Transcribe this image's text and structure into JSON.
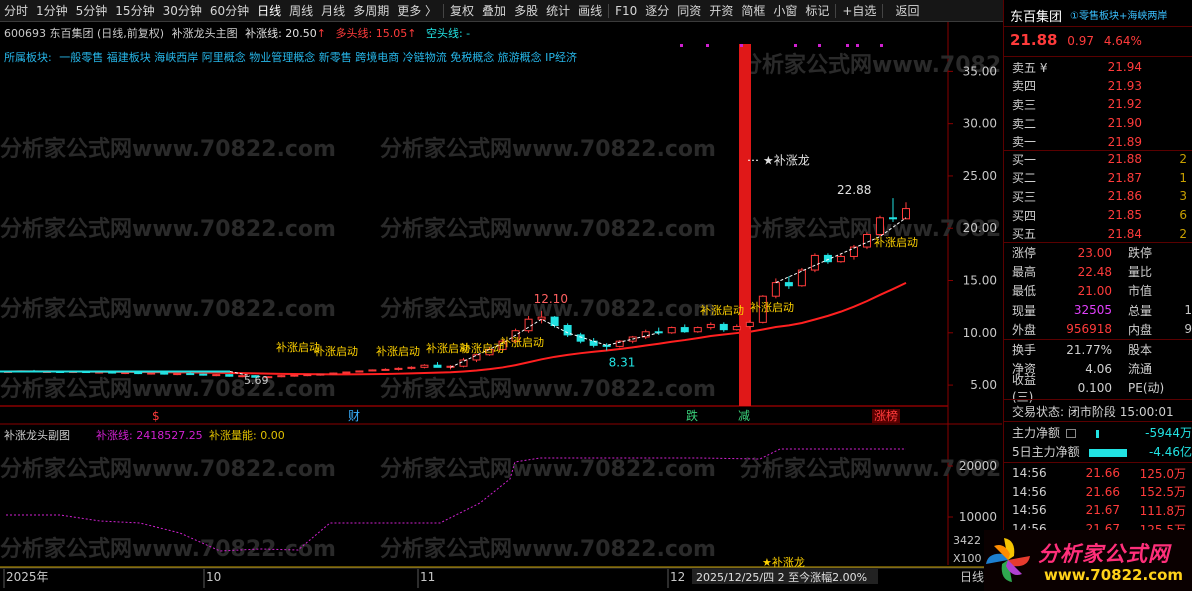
{
  "toolbar": {
    "items": [
      "分时",
      "1分钟",
      "5分钟",
      "15分钟",
      "30分钟",
      "60分钟",
      "日线",
      "周线",
      "月线",
      "多周期",
      "更多 〉",
      "复权",
      "叠加",
      "多股",
      "统计",
      "画线",
      "F10",
      "逐分",
      "同资",
      "开资",
      "简框",
      "小窗",
      "标记",
      "+自选",
      "返回"
    ],
    "active": "日线"
  },
  "main_chart": {
    "code_name": "600693 东百集团 (日线,前复权)",
    "indicator_name": "补涨龙头主图",
    "buzhang_label": "补涨线:",
    "buzhang_value": "20.50",
    "duotou_label": "多头线:",
    "duotou_value": "15.05",
    "kongtou_label": "空头线:",
    "kongtou_value": "-",
    "sectors_label": "所属板块:",
    "sectors": "一般零售 福建板块 海峡西岸 阿里概念 物业管理概念 新零售 跨境电商 冷链物流 免税概念 旅游概念 IP经济"
  },
  "chart_data": [
    {
      "type": "candlestick",
      "ylim": [
        3,
        38
      ],
      "y_ticks": [
        "35.00",
        "30.00",
        "25.00",
        "20.00",
        "15.00",
        "10.00",
        "5.00"
      ],
      "annotations": {
        "high1": "12.10",
        "low1": "8.31",
        "high2": "22.88",
        "low0": "5.69",
        "dragon": "★补涨龙",
        "start_label": "补涨启动"
      },
      "bottom_markers": [
        "$",
        "财",
        "跌",
        "减",
        "涨榜"
      ]
    },
    {
      "type": "line",
      "title": "补涨龙头副图",
      "series_label": "补涨线:",
      "series_value": "2418527.25",
      "energy_label": "补涨量能:",
      "energy_value": "0.00",
      "y_ticks": [
        "20000",
        "10000"
      ],
      "extra_ticks": [
        "3422",
        "X100"
      ],
      "bottom_annotation": "★补涨龙"
    }
  ],
  "timeline": {
    "labels": [
      "2025年",
      "10",
      "11",
      "12"
    ],
    "cursor": "2025/12/25/四 2 至今涨幅2.00%",
    "right_tag": "日线"
  },
  "quote": {
    "name": "东百集团",
    "sector": "①零售板块+海峡两岸",
    "price": "21.88",
    "change": "0.97",
    "pct": "4.64%",
    "sells": [
      {
        "label": "卖五 ¥",
        "price": "21.94"
      },
      {
        "label": "卖四",
        "price": "21.93"
      },
      {
        "label": "卖三",
        "price": "21.92"
      },
      {
        "label": "卖二",
        "price": "21.90"
      },
      {
        "label": "卖一",
        "price": "21.89"
      }
    ],
    "buys": [
      {
        "label": "买一",
        "price": "21.88",
        "tail": "2"
      },
      {
        "label": "买二",
        "price": "21.87",
        "tail": "1"
      },
      {
        "label": "买三",
        "price": "21.86",
        "tail": "3"
      },
      {
        "label": "买四",
        "price": "21.85",
        "tail": "6"
      },
      {
        "label": "买五",
        "price": "21.84",
        "tail": "2"
      }
    ],
    "stats": [
      {
        "l1": "涨停",
        "v1": "23.00",
        "c1": "#ff3b3b",
        "l2": "跌停",
        "v2": ""
      },
      {
        "l1": "最高",
        "v1": "22.48",
        "c1": "#ff3b3b",
        "l2": "量比",
        "v2": ""
      },
      {
        "l1": "最低",
        "v1": "21.00",
        "c1": "#ff3b3b",
        "l2": "市值",
        "v2": ""
      },
      {
        "l1": "现量",
        "v1": "32505",
        "c1": "#e040fb",
        "l2": "总量",
        "v2": "1"
      },
      {
        "l1": "外盘",
        "v1": "956918",
        "c1": "#ff3b3b",
        "l2": "内盘",
        "v2": "9"
      }
    ],
    "stats2": [
      {
        "l1": "换手",
        "v1": "21.77%",
        "c1": "#d0d0d0",
        "l2": "股本",
        "v2": ""
      },
      {
        "l1": "净资",
        "v1": "4.06",
        "c1": "#d0d0d0",
        "l2": "流通",
        "v2": ""
      },
      {
        "l1": "收益(三)",
        "v1": "0.100",
        "c1": "#d0d0d0",
        "l2": "PE(动)",
        "v2": ""
      }
    ],
    "trade_status_label": "交易状态:",
    "trade_status": "闭市阶段 15:00:01",
    "main_flow_label": "主力净额",
    "main_flow": "-5944万",
    "main_flow5_label": "5日主力净额",
    "main_flow5": "-4.46亿",
    "ticks": [
      {
        "time": "14:56",
        "price": "21.66",
        "amount": "125.0万"
      },
      {
        "time": "14:56",
        "price": "21.66",
        "amount": "152.5万"
      },
      {
        "time": "14:56",
        "price": "21.67",
        "amount": "111.8万"
      },
      {
        "time": "14:56",
        "price": "21.67",
        "amount": "125.5万"
      }
    ]
  },
  "logo": {
    "title": "分析家公式网",
    "url": "www.70822.com"
  },
  "colors": {
    "up": "#ff3b3b",
    "down": "#22e3e3",
    "axis": "#8a0000",
    "label": "#ffd200",
    "purple": "#d020d0"
  }
}
